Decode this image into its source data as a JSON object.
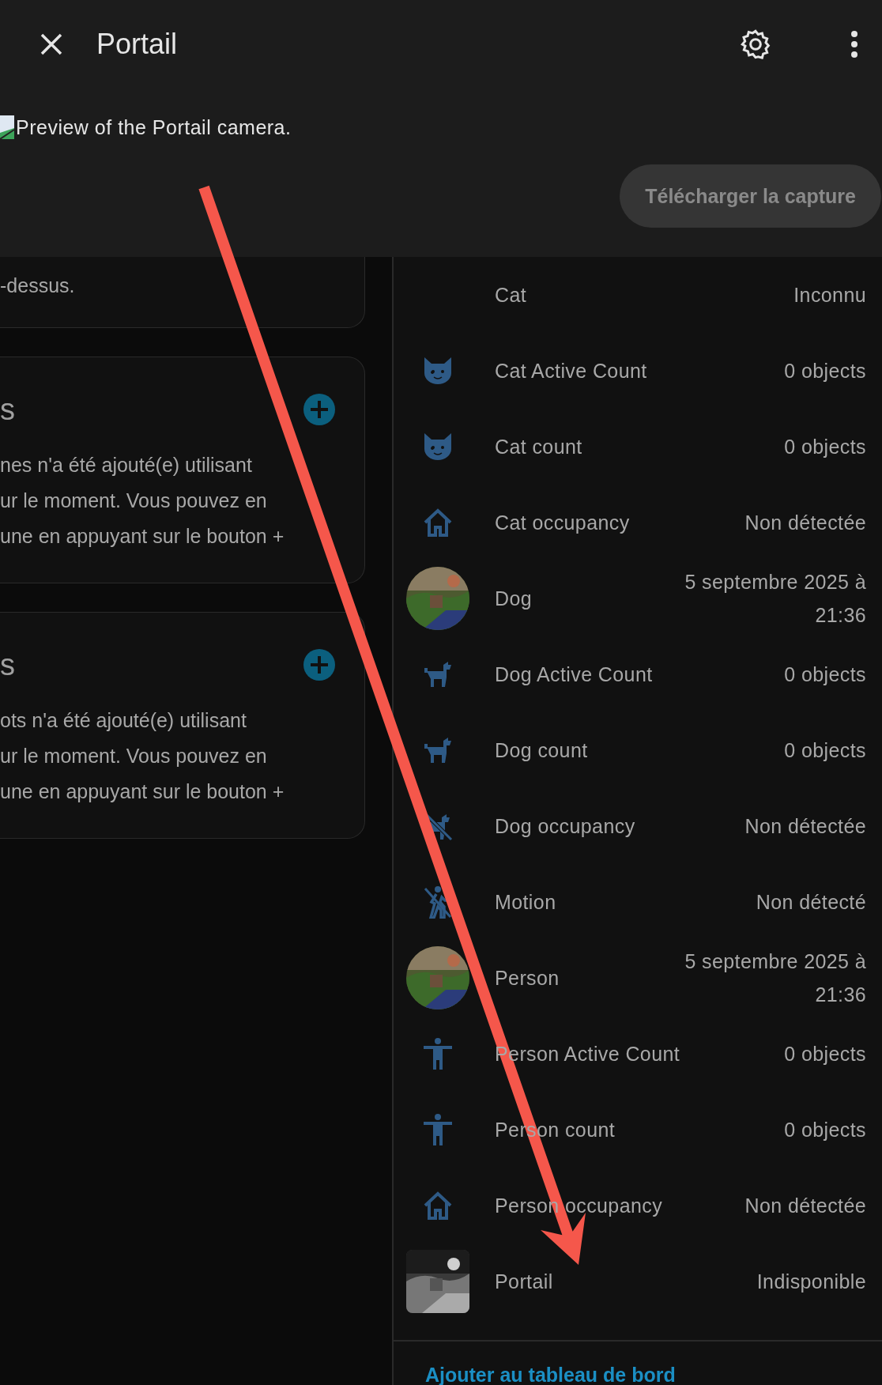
{
  "header": {
    "title": "Portail",
    "preview_alt": "Preview of the Portail camera.",
    "capture_button": "Télécharger la capture"
  },
  "background_cards": [
    {
      "lines": [
        "-dessus."
      ]
    },
    {
      "heading": "s",
      "lines": [
        "nes n'a été ajouté(e) utilisant",
        "ur le moment. Vous pouvez en",
        "une en appuyant sur le bouton +"
      ]
    },
    {
      "heading": "s",
      "lines": [
        "ots n'a été ajouté(e) utilisant",
        "ur le moment. Vous pouvez en",
        "une en appuyant sur le bouton +"
      ]
    }
  ],
  "entities": [
    {
      "kind": "none",
      "name": "Cat",
      "state": "Inconnu"
    },
    {
      "kind": "cat",
      "name": "Cat Active Count",
      "state": "0 objects"
    },
    {
      "kind": "cat",
      "name": "Cat count",
      "state": "0 objects"
    },
    {
      "kind": "house",
      "name": "Cat occupancy",
      "state": "Non détectée"
    },
    {
      "kind": "picture-round",
      "name": "Dog",
      "state": "5 septembre 2025 à 21:36"
    },
    {
      "kind": "dog",
      "name": "Dog Active Count",
      "state": "0 objects"
    },
    {
      "kind": "dog",
      "name": "Dog count",
      "state": "0 objects"
    },
    {
      "kind": "dog-off",
      "name": "Dog occupancy",
      "state": "Non détectée"
    },
    {
      "kind": "walk",
      "name": "Motion",
      "state": "Non détecté"
    },
    {
      "kind": "picture-round",
      "name": "Person",
      "state": "5 septembre 2025 à 21:36"
    },
    {
      "kind": "person",
      "name": "Person Active Count",
      "state": "0 objects"
    },
    {
      "kind": "person",
      "name": "Person count",
      "state": "0 objects"
    },
    {
      "kind": "house",
      "name": "Person occupancy",
      "state": "Non détectée"
    },
    {
      "kind": "picture-square",
      "name": "Portail",
      "state": "Indisponible"
    }
  ],
  "footer_link": "Ajouter au tableau de bord"
}
